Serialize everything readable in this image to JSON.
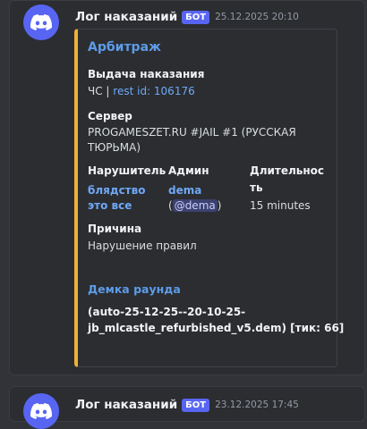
{
  "messages": [
    {
      "author": "Лог наказаний",
      "badge": "БОТ",
      "timestamp": "25.12.2025 20:10",
      "embed": {
        "accent_color": "#f0b132",
        "title": "Арбитраж",
        "action": {
          "label": "Выдача наказания",
          "value_prefix": "ЧС | ",
          "value_link": "rest id: 106176"
        },
        "server": {
          "label": "Сервер",
          "line1": "PROGAMESZET.RU #JAIL #1 (РУССКАЯ",
          "line2": "ТЮРЬМА)"
        },
        "violator": {
          "label": "Нарушитель",
          "line1": "блядство",
          "line2": "это все"
        },
        "admin": {
          "label": "Админ",
          "name": "dema",
          "mention": "@dema",
          "open_paren": "(",
          "close_paren": ")"
        },
        "duration": {
          "label_line1": "Длительнос",
          "label_line2": "ть",
          "value": "15 minutes"
        },
        "reason": {
          "label": "Причина",
          "value": "Нарушение правил"
        },
        "demo": {
          "label": "Демка раунда",
          "line1": "(auto-25-12-25--20-10-25-",
          "line2": "jb_mlcastle_refurbished_v5.dem) [тик: 66]"
        }
      }
    },
    {
      "author": "Лог наказаний",
      "badge": "БОТ",
      "timestamp": "23.12.2025 17:45"
    }
  ],
  "colors": {
    "background": "#313338",
    "card": "#2b2d31",
    "blurple": "#5865f2",
    "link": "#6fa8f5"
  }
}
